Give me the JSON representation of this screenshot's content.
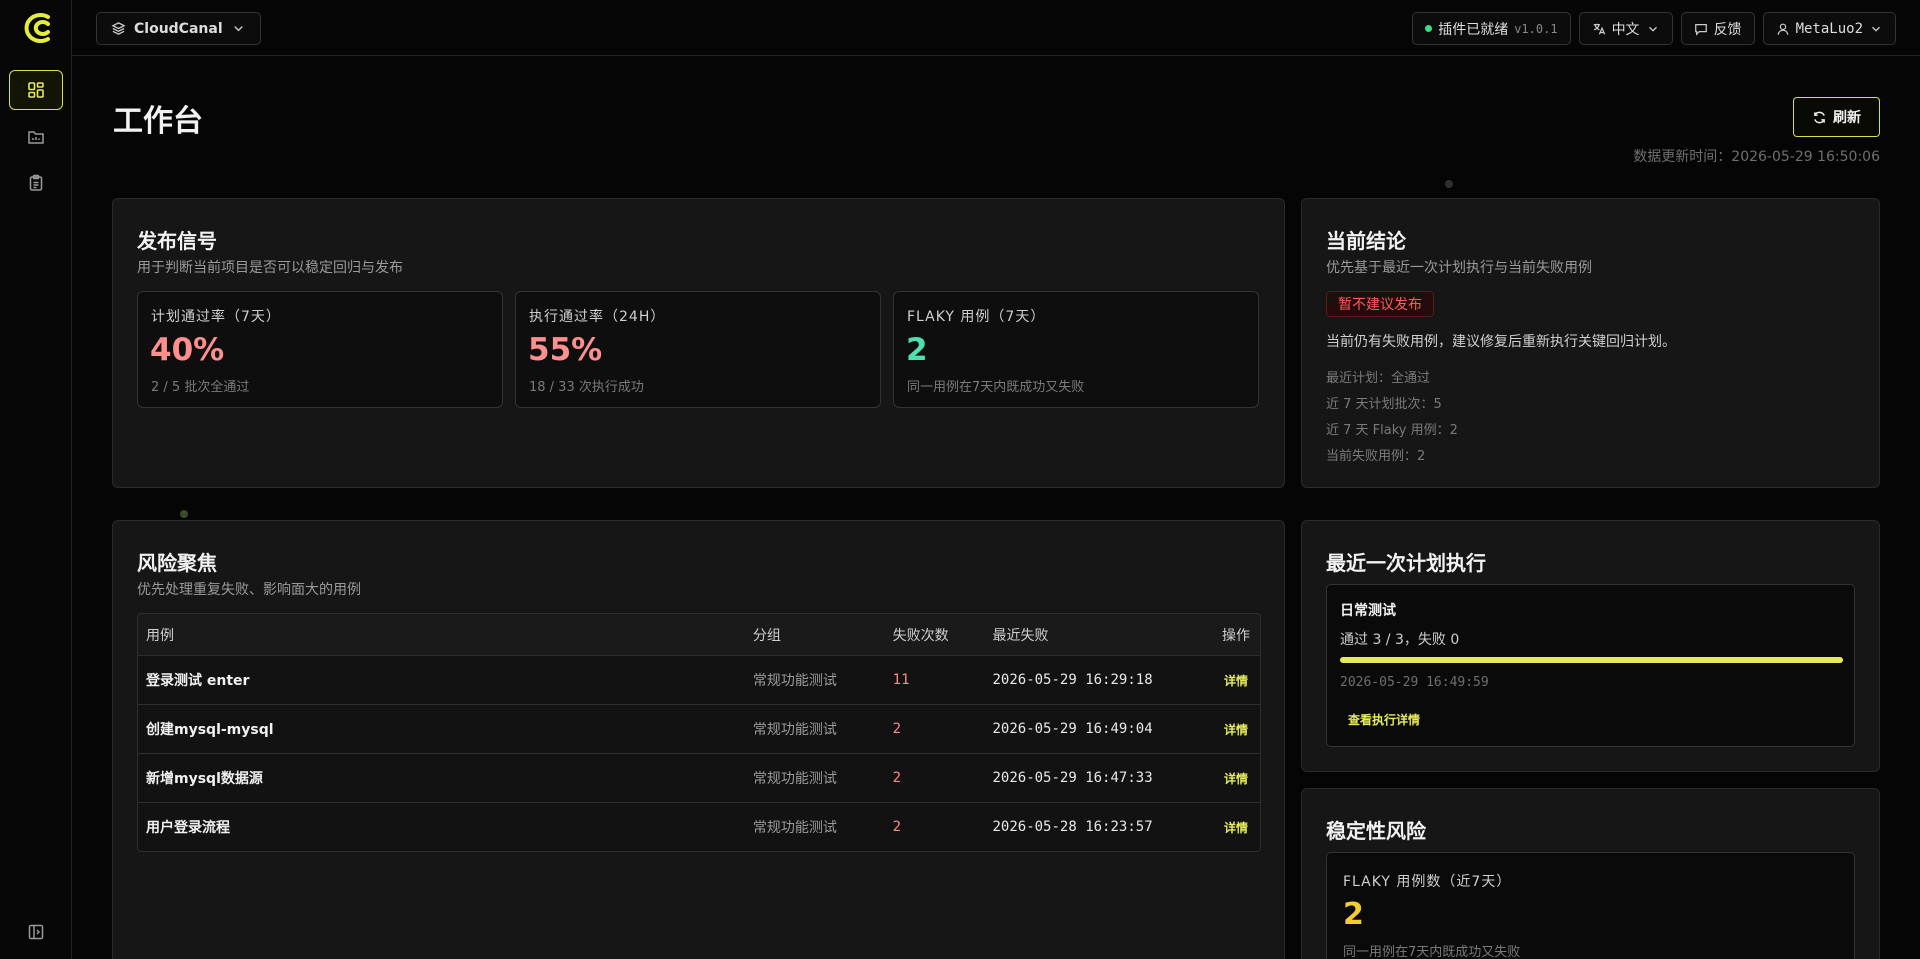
{
  "sidebar": {
    "items": [
      {
        "name": "dashboard",
        "icon": "grid-icon"
      },
      {
        "name": "reports",
        "icon": "folder-chart-icon"
      },
      {
        "name": "plans",
        "icon": "clipboard-icon"
      }
    ],
    "collapse_icon": "sidebar-collapse-icon"
  },
  "topbar": {
    "project": "CloudCanal",
    "plugin_status": "插件已就绪",
    "plugin_version": "v1.0.1",
    "language": "中文",
    "feedback": "反馈",
    "user": "MetaLuo2"
  },
  "page": {
    "title": "工作台",
    "refresh_label": "刷新",
    "update_time": "数据更新时间：2026-05-29 16:50:06"
  },
  "release_signal": {
    "title": "发布信号",
    "subtitle": "用于判断当前项目是否可以稳定回归与发布",
    "metrics": [
      {
        "label": "计划通过率（7天）",
        "value": "40%",
        "note": "2 / 5 批次全通过",
        "color": "#ff8f8f"
      },
      {
        "label": "执行通过率（24H）",
        "value": "55%",
        "note": "18 / 33 次执行成功",
        "color": "#ff8f8f"
      },
      {
        "label": "FLAKY 用例（7天）",
        "value": "2",
        "note": "同一用例在7天内既成功又失败",
        "color": "#4fe0b0"
      }
    ]
  },
  "conclusion": {
    "title": "当前结论",
    "subtitle": "优先基于最近一次计划执行与当前失败用例",
    "badge": "暂不建议发布",
    "text": "当前仍有失败用例，建议修复后重新执行关键回归计划。",
    "stats": [
      "最近计划：全通过",
      "近 7 天计划批次：5",
      "近 7 天 Flaky 用例：2",
      "当前失败用例：2"
    ]
  },
  "risk": {
    "title": "风险聚焦",
    "subtitle": "优先处理重复失败、影响面大的用例",
    "columns": [
      "用例",
      "分组",
      "失败次数",
      "最近失败",
      "操作"
    ],
    "rows": [
      {
        "case": "登录测试 enter",
        "group": "常规功能测试",
        "fails": "11",
        "last": "2026-05-29 16:29:18",
        "action": "详情"
      },
      {
        "case": "创建mysql-mysql",
        "group": "常规功能测试",
        "fails": "2",
        "last": "2026-05-29 16:49:04",
        "action": "详情"
      },
      {
        "case": "新增mysql数据源",
        "group": "常规功能测试",
        "fails": "2",
        "last": "2026-05-29 16:47:33",
        "action": "详情"
      },
      {
        "case": "用户登录流程",
        "group": "常规功能测试",
        "fails": "2",
        "last": "2026-05-28 16:23:57",
        "action": "详情"
      }
    ]
  },
  "latest_exec": {
    "title": "最近一次计划执行",
    "name": "日常测试",
    "result": "通过 3 / 3，失败 0",
    "progress": 1.0,
    "time": "2026-05-29 16:49:59",
    "link": "查看执行详情"
  },
  "stability": {
    "title": "稳定性风险",
    "label": "FLAKY 用例数（近7天）",
    "value": "2",
    "note": "同一用例在7天内既成功又失败"
  }
}
